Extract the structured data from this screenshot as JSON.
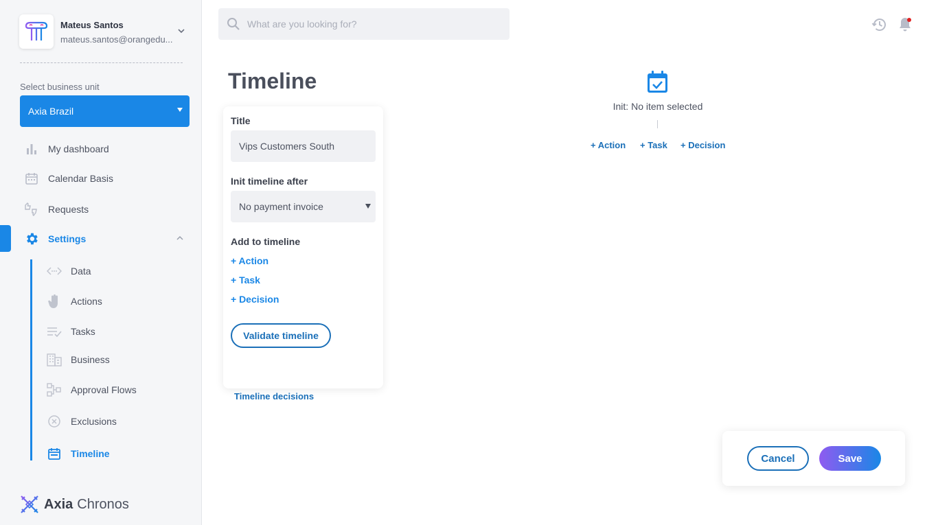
{
  "user": {
    "name": "Mateus Santos",
    "email": "mateus.santos@orangedu..."
  },
  "business_unit": {
    "label": "Select business unit",
    "selected": "Axia Brazil"
  },
  "nav": {
    "dashboard": "My dashboard",
    "calendar": "Calendar Basis",
    "requests": "Requests",
    "settings": "Settings",
    "sub": {
      "data": "Data",
      "actions": "Actions",
      "tasks": "Tasks",
      "business": "Business",
      "approval_flows": "Approval Flows",
      "exclusions": "Exclusions",
      "timeline": "Timeline"
    }
  },
  "brand": {
    "name_bold": "Axia",
    "name_light": "Chronos"
  },
  "search": {
    "placeholder": "What are you looking for?"
  },
  "page": {
    "title": "Timeline"
  },
  "panel": {
    "title_label": "Title",
    "title_value": "Vips Customers South",
    "init_label": "Init timeline after",
    "init_value": "No payment invoice",
    "add_label": "Add to timeline",
    "add_action": "+ Action",
    "add_task": "+ Task",
    "add_decision": "+ Decision",
    "validate": "Validate timeline"
  },
  "timeline_decisions": "Timeline decisions",
  "canvas": {
    "init_text": "Init: No item selected",
    "add_action": "+ Action",
    "add_task": "+ Task",
    "add_decision": "+ Decision"
  },
  "footer": {
    "cancel": "Cancel",
    "save": "Save"
  },
  "colors": {
    "accent": "#1a87e6",
    "save_gradient_start": "#8f5bf0",
    "notification_dot": "#e02020"
  }
}
